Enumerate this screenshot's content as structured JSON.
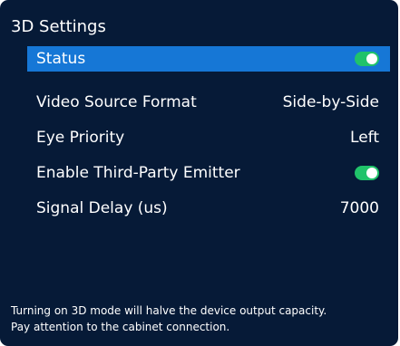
{
  "panel": {
    "title": "3D Settings",
    "items": [
      {
        "label": "Status",
        "type": "toggle",
        "on": true,
        "selected": true
      },
      {
        "label": "Video Source Format",
        "value": "Side-by-Side"
      },
      {
        "label": "Eye Priority",
        "value": "Left"
      },
      {
        "label": "Enable Third-Party Emitter",
        "type": "toggle",
        "on": true
      },
      {
        "label": "Signal Delay (us)",
        "value": "7000"
      }
    ]
  },
  "footer": {
    "line1": "Turning on 3D mode will halve the device output capacity.",
    "line2": "Pay attention to the cabinet connection."
  },
  "colors": {
    "background": "#061a37",
    "selected": "#1677d6",
    "toggle_on": "#20c36a"
  }
}
